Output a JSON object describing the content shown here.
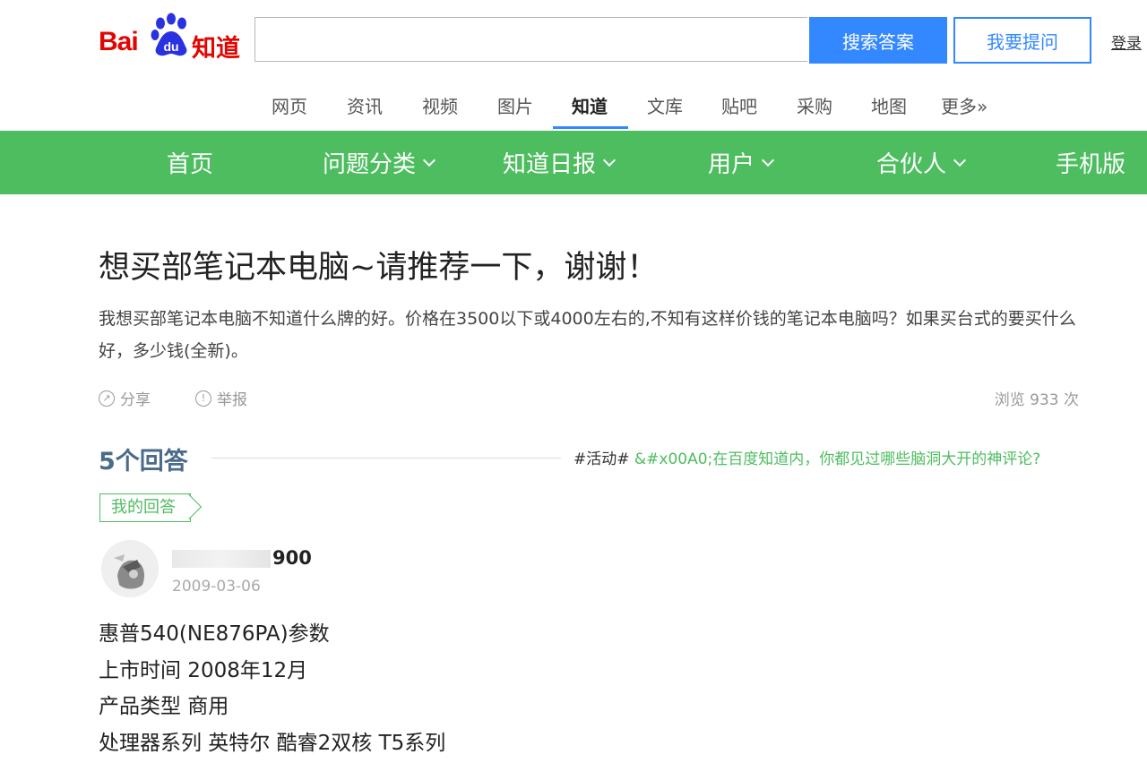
{
  "header": {
    "logo_bai": "Bai",
    "logo_du": "du",
    "logo_zhidao": "知道",
    "search_placeholder": "",
    "search_button": "搜索答案",
    "ask_button": "我要提问",
    "login_link": "登录"
  },
  "tabs": [
    "网页",
    "资讯",
    "视频",
    "图片",
    "知道",
    "文库",
    "贴吧",
    "采购",
    "地图",
    "更多»"
  ],
  "active_tab": "知道",
  "nav": [
    "首页",
    "问题分类",
    "知道日报",
    "用户",
    "合伙人",
    "手机版"
  ],
  "question": {
    "title": "想买部笔记本电脑~请推荐一下，谢谢！",
    "description": "我想买部笔记本电脑不知道什么牌的好。价格在3500以下或4000左右的,不知有这样价钱的笔记本电脑吗？如果买台式的要买什么好，多少钱(全新)。",
    "share": "分享",
    "report": "举报",
    "views": "浏览 933 次"
  },
  "answers_section": {
    "count": "5个回答",
    "activity_tag": "#活动#",
    "activity_text": "&#x00A0;在百度知道内，你都见过哪些脑洞大开的神评论?"
  },
  "my_answer_badge": "我的回答",
  "answer": {
    "user_name_suffix": "900",
    "date": "2009-03-06",
    "lines": [
      "惠普540(NE876PA)参数",
      "上市时间 2008年12月",
      "产品类型 商用",
      "处理器系列 英特尔 酷睿2双核 T5系列"
    ]
  },
  "colors": {
    "brand_red": "#e10601",
    "brand_blue": "#2932e1",
    "accent_blue": "#3388ff",
    "nav_green": "#4dbd5f"
  }
}
